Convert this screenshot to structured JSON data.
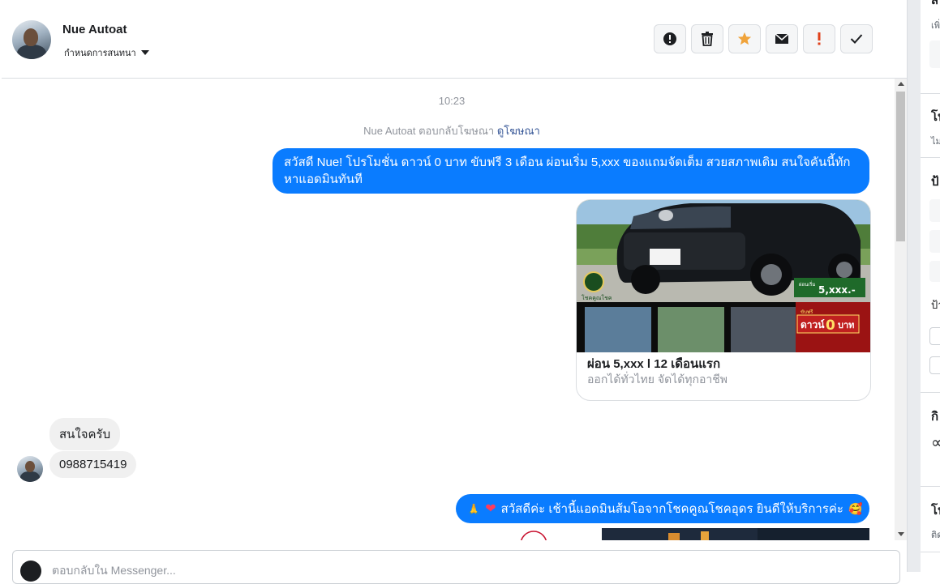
{
  "header": {
    "contact_name": "Nue Autoat",
    "assign_label": "กำหนดการสนทนา"
  },
  "actions": [
    {
      "name": "report-spam-button",
      "icon": "alert-circle-icon"
    },
    {
      "name": "delete-button",
      "icon": "trash-icon"
    },
    {
      "name": "star-button",
      "icon": "star-icon",
      "color": "#f0a33a"
    },
    {
      "name": "mark-unread-button",
      "icon": "envelope-icon"
    },
    {
      "name": "follow-up-button",
      "icon": "exclamation-icon",
      "color": "#e0401a"
    },
    {
      "name": "mark-done-button",
      "icon": "checkmark-icon"
    }
  ],
  "conversation": {
    "timestamp": "10:23",
    "ad_reply_text": "Nue Autoat ตอบกลับโฆษณา",
    "ad_reply_link": "ดูโฆษณา",
    "msg_promo": "สวัสดี Nue! โปรโมชั่น ดาวน์ 0 บาท ขับฟรี 3 เดือน ผ่อนเริ่ม 5,xxx ของแถมจัดเต็ม สวยสภาพเดิม สนใจคันนี้ทักหาแอดมินทันที",
    "card": {
      "title": "ผ่อน 5,xxx l 12 เดือนแรก",
      "subtitle": "ออกได้ทั่วไทย จัดได้ทุกอาชีพ",
      "img_price_small": "ผ่อนเริ่ม",
      "img_price_small2": "5,xxx.-",
      "img_down_label": "ดาวน์",
      "img_down_value": "0",
      "img_down_unit": "บาท",
      "img_badge_small": "โชคคูณโชค",
      "img_promo_small": "ขับฟรี"
    },
    "msg_interested": "สนใจครับ",
    "msg_phone": "0988715419",
    "msg_greeting": "สวัสดีค่ะ เช้านี้แอดมินส้มโอจากโชคคูณโชคอุดร ยินดีให้บริการค่ะ"
  },
  "reply": {
    "placeholder": "ตอบกลับใน Messenger..."
  },
  "right_panel": {
    "label_1": "เพิ่",
    "label_2": "โน",
    "label_3": "ไม่",
    "label_4": "ป้",
    "label_5": "ป้า",
    "label_6": "กิ",
    "label_7": "∝",
    "label_8": "โน",
    "label_9": "ติด",
    "label_0": "ส"
  }
}
